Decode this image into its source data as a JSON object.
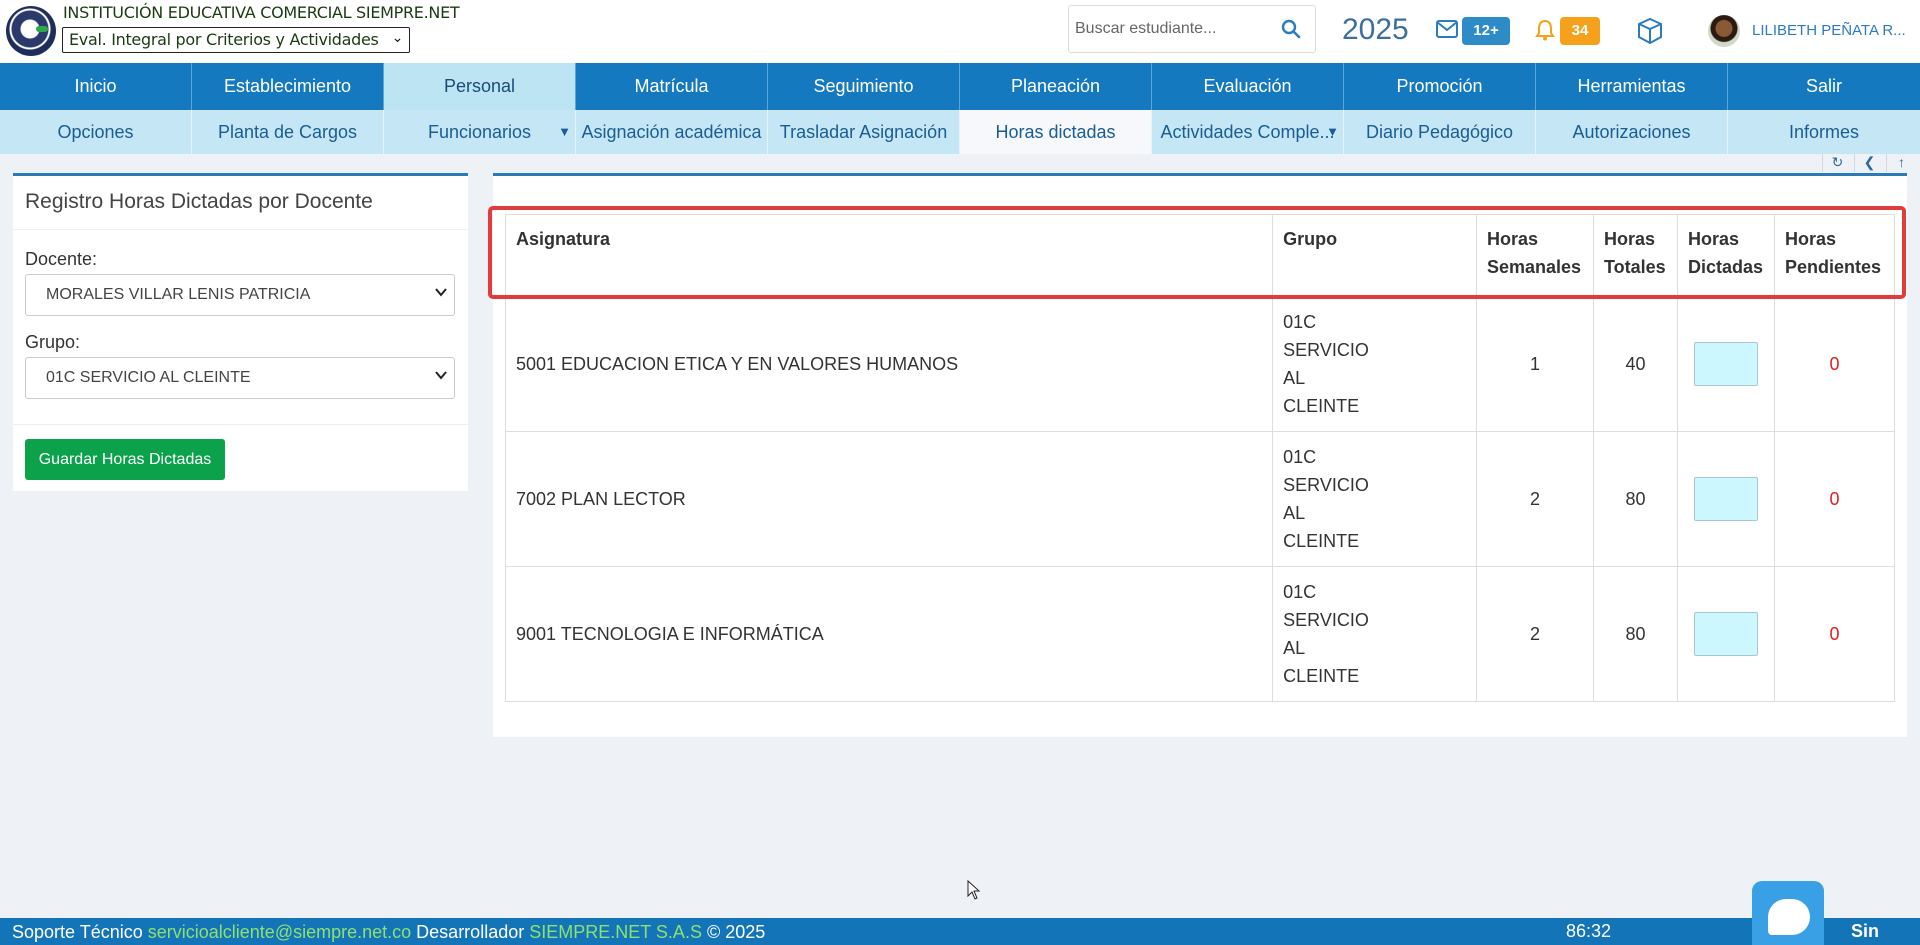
{
  "header": {
    "institution": "INSTITUCIÓN EDUCATIVA COMERCIAL SIEMPRE.NET",
    "eval_mode": "Eval. Integral por Criterios y Actividades",
    "search_placeholder": "Buscar estudiante...",
    "year": "2025",
    "mail_count": "12+",
    "notification_count": "34",
    "user_name": "LILIBETH PEÑATA R...",
    "colors": {
      "mail_badge": "#2d8bc7",
      "bell_badge": "#f5a11b"
    }
  },
  "nav_main": [
    "Inicio",
    "Establecimiento",
    "Personal",
    "Matrícula",
    "Seguimiento",
    "Planeación",
    "Evaluación",
    "Promoción",
    "Herramientas",
    "Salir"
  ],
  "nav_main_active": "Personal",
  "nav_sub": [
    "Opciones",
    "Planta de Cargos",
    "Funcionarios",
    "Asignación académica",
    "Trasladar Asignación",
    "Horas dictadas",
    "Actividades Comple...",
    "Diario Pedagógico",
    "Autorizaciones",
    "Informes"
  ],
  "nav_sub_active": "Horas dictadas",
  "form": {
    "title": "Registro Horas Dictadas por Docente",
    "docente_label": "Docente:",
    "docente_value": "MORALES VILLAR LENIS PATRICIA",
    "grupo_label": "Grupo:",
    "grupo_value": "01C SERVICIO AL CLEINTE",
    "save_label": "Guardar Horas Dictadas"
  },
  "table": {
    "headers": {
      "asignatura": "Asignatura",
      "grupo": "Grupo",
      "semanales": [
        "Horas",
        "Semanales"
      ],
      "totales": [
        "Horas",
        "Totales"
      ],
      "dictadas": [
        "Horas",
        "Dictadas"
      ],
      "pendientes": [
        "Horas",
        "Pendientes"
      ]
    },
    "rows": [
      {
        "asignatura": "5001 EDUCACION ETICA Y EN VALORES HUMANOS",
        "grupo": [
          "01C",
          "SERVICIO",
          "AL",
          "CLEINTE"
        ],
        "semanales": "1",
        "totales": "40",
        "dictadas": "",
        "pendientes": "0"
      },
      {
        "asignatura": "7002 PLAN LECTOR",
        "grupo": [
          "01C",
          "SERVICIO",
          "AL",
          "CLEINTE"
        ],
        "semanales": "2",
        "totales": "80",
        "dictadas": "",
        "pendientes": "0"
      },
      {
        "asignatura": "9001 TECNOLOGIA E INFORMÁTICA",
        "grupo": [
          "01C",
          "SERVICIO",
          "AL",
          "CLEINTE"
        ],
        "semanales": "2",
        "totales": "80",
        "dictadas": "",
        "pendientes": "0"
      }
    ]
  },
  "footer": {
    "support_label": "Soporte Técnico",
    "support_email": "servicioalcliente@siempre.net.co",
    "developer_label": "Desarrollador",
    "developer": "SIEMPRE.NET S.A.S",
    "copyright": "© 2025",
    "timer": "86:32",
    "brand": "Sin"
  }
}
